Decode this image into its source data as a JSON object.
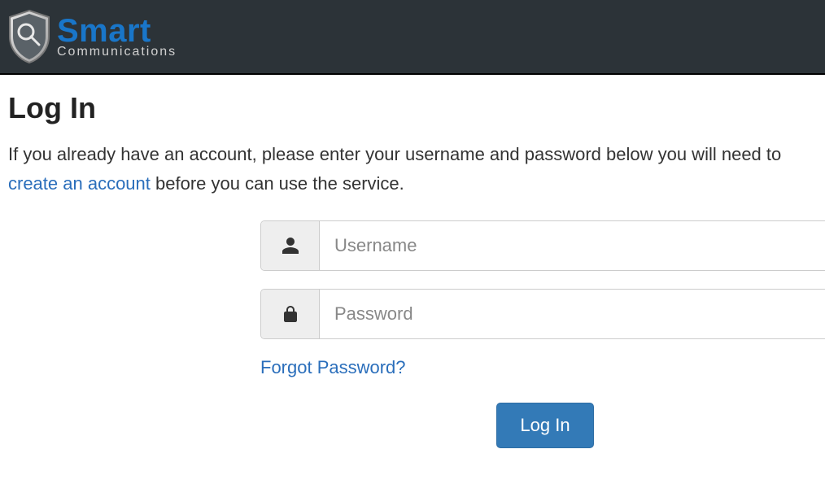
{
  "brand": {
    "name_top": "Smart",
    "name_bottom": "Communications"
  },
  "page": {
    "title": "Log In",
    "intro_before": "If you already have an account, please enter your username and password below",
    "intro_mid": " you will need to ",
    "create_link": "create an account",
    "intro_after": " before you can use the service."
  },
  "form": {
    "username_placeholder": "Username",
    "password_placeholder": "Password",
    "forgot_label": "Forgot Password?",
    "submit_label": "Log In"
  },
  "colors": {
    "accent": "#337ab7",
    "link": "#2a6ebb",
    "header_bg": "#2c3338"
  }
}
